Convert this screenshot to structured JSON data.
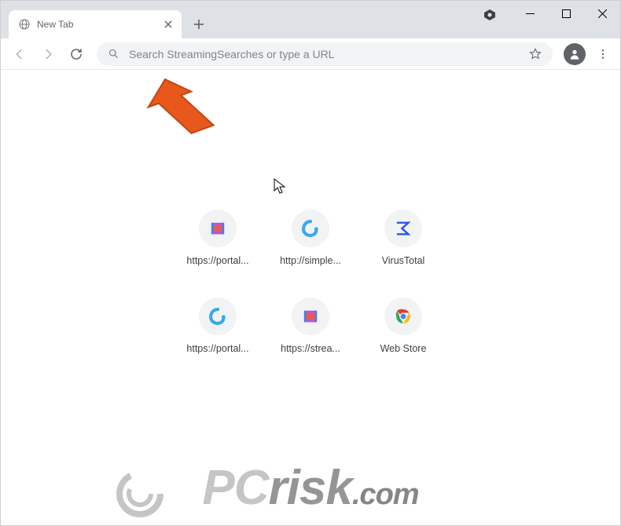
{
  "window": {
    "tab_title": "New Tab",
    "omnibox_placeholder": "Search StreamingSearches or type a URL"
  },
  "shortcuts": [
    {
      "label": "https://portal...",
      "icon": "movie"
    },
    {
      "label": "http://simple...",
      "icon": "edge-swirl"
    },
    {
      "label": "VirusTotal",
      "icon": "vt-sigma"
    },
    {
      "label": "https://portal...",
      "icon": "edge-swirl"
    },
    {
      "label": "https://strea...",
      "icon": "movie"
    },
    {
      "label": "Web Store",
      "icon": "chrome"
    }
  ],
  "watermark": {
    "pc": "PC",
    "risk": "risk",
    "domain": ".com"
  }
}
